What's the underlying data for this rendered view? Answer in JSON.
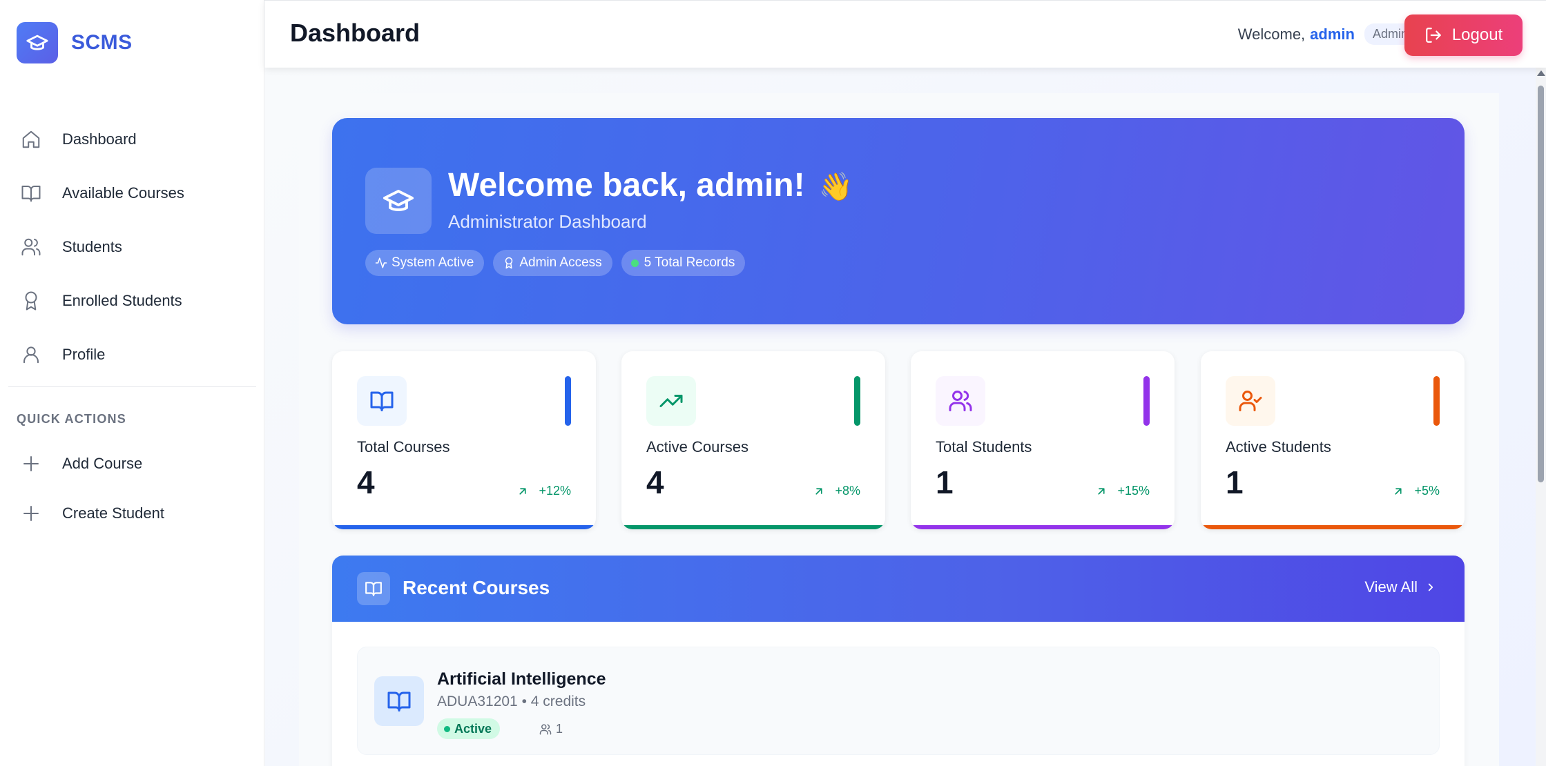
{
  "app": {
    "name": "SCMS"
  },
  "sidebar": {
    "items": [
      {
        "label": "Dashboard",
        "icon": "home-icon"
      },
      {
        "label": "Available Courses",
        "icon": "book-icon"
      },
      {
        "label": "Students",
        "icon": "users-icon"
      },
      {
        "label": "Enrolled Students",
        "icon": "award-icon"
      },
      {
        "label": "Profile",
        "icon": "user-icon"
      }
    ],
    "quick_actions_title": "QUICK ACTIONS",
    "quick_actions": [
      {
        "label": "Add Course",
        "icon": "plus-icon"
      },
      {
        "label": "Create Student",
        "icon": "plus-icon"
      }
    ]
  },
  "header": {
    "title": "Dashboard",
    "welcome_prefix": "Welcome,",
    "username": "admin",
    "role": "Admin",
    "logout_label": "Logout"
  },
  "hero": {
    "title": "Welcome back, admin!",
    "wave": "👋",
    "subtitle": "Administrator Dashboard",
    "tags": [
      {
        "label": "System Active",
        "icon": "activity-icon"
      },
      {
        "label": "Admin Access",
        "icon": "award-icon"
      },
      {
        "label": "5 Total Records",
        "icon": "status-dot"
      }
    ]
  },
  "stats": [
    {
      "label": "Total Courses",
      "value": "4",
      "trend": "+12%",
      "icon": "book-icon",
      "color": "#2563eb",
      "bg": "#eff6ff"
    },
    {
      "label": "Active Courses",
      "value": "4",
      "trend": "+8%",
      "icon": "trending-up-icon",
      "color": "#059669",
      "bg": "#ecfdf5"
    },
    {
      "label": "Total Students",
      "value": "1",
      "trend": "+15%",
      "icon": "users-icon",
      "color": "#9333ea",
      "bg": "#faf5ff"
    },
    {
      "label": "Active Students",
      "value": "1",
      "trend": "+5%",
      "icon": "user-check-icon",
      "color": "#ea580c",
      "bg": "#fff7ed"
    }
  ],
  "recent_courses": {
    "title": "Recent Courses",
    "view_all_label": "View All",
    "courses": [
      {
        "name": "Artificial Intelligence",
        "meta": "ADUA31201 • 4 credits",
        "status": "Active",
        "enrolled": "1"
      }
    ]
  },
  "colors": {
    "primary": "#2563eb",
    "logout_gradient_start": "#e8424f",
    "logout_gradient_end": "#ec3f7a",
    "hero_start": "#3d72ee",
    "hero_end": "#6155e6"
  }
}
